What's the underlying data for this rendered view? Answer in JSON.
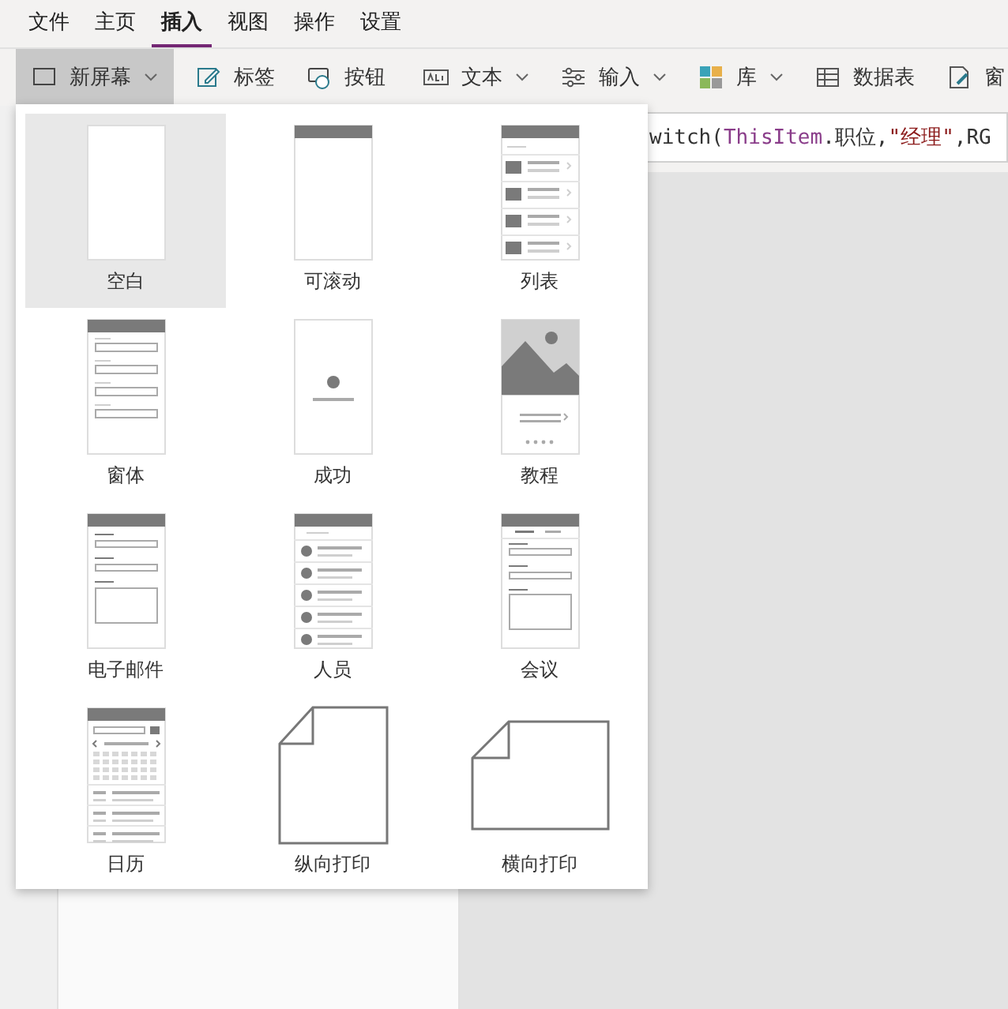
{
  "menu_tabs": [
    {
      "label": "文件",
      "selected": false
    },
    {
      "label": "主页",
      "selected": false
    },
    {
      "label": "插入",
      "selected": true
    },
    {
      "label": "视图",
      "selected": false
    },
    {
      "label": "操作",
      "selected": false
    },
    {
      "label": "设置",
      "selected": false
    }
  ],
  "toolbar": [
    {
      "label": "新屏幕",
      "kind": "screen",
      "dropdown": true,
      "selected": true
    },
    {
      "label": "标签",
      "kind": "edit",
      "dropdown": false,
      "selected": false
    },
    {
      "label": "按钮",
      "kind": "button",
      "dropdown": false,
      "selected": false
    },
    {
      "label": "文本",
      "kind": "text",
      "dropdown": true,
      "selected": false
    },
    {
      "label": "输入",
      "kind": "sliders",
      "dropdown": true,
      "selected": false
    },
    {
      "label": "库",
      "kind": "gallery",
      "dropdown": true,
      "selected": false
    },
    {
      "label": "数据表",
      "kind": "table",
      "dropdown": false,
      "selected": false
    },
    {
      "label": "窗",
      "kind": "form",
      "dropdown": false,
      "selected": false
    }
  ],
  "formula": [
    {
      "kind": "plain",
      "text": "witch("
    },
    {
      "kind": "keyword",
      "text": "ThisItem"
    },
    {
      "kind": "plain",
      "text": ".职位,"
    },
    {
      "kind": "string",
      "text": "\"经理\""
    },
    {
      "kind": "plain",
      "text": ",RG"
    }
  ],
  "screen_templates": [
    {
      "label": "空白",
      "kind": "blank",
      "selected": true
    },
    {
      "label": "可滚动",
      "kind": "scrollable",
      "selected": false
    },
    {
      "label": "列表",
      "kind": "list",
      "selected": false
    },
    {
      "label": "窗体",
      "kind": "form",
      "selected": false
    },
    {
      "label": "成功",
      "kind": "success",
      "selected": false
    },
    {
      "label": "教程",
      "kind": "tutorial",
      "selected": false
    },
    {
      "label": "电子邮件",
      "kind": "email",
      "selected": false
    },
    {
      "label": "人员",
      "kind": "people",
      "selected": false
    },
    {
      "label": "会议",
      "kind": "meeting",
      "selected": false
    },
    {
      "label": "日历",
      "kind": "calendar",
      "selected": false
    },
    {
      "label": "纵向打印",
      "kind": "portrait",
      "selected": false
    },
    {
      "label": "横向打印",
      "kind": "landscape",
      "selected": false
    }
  ]
}
